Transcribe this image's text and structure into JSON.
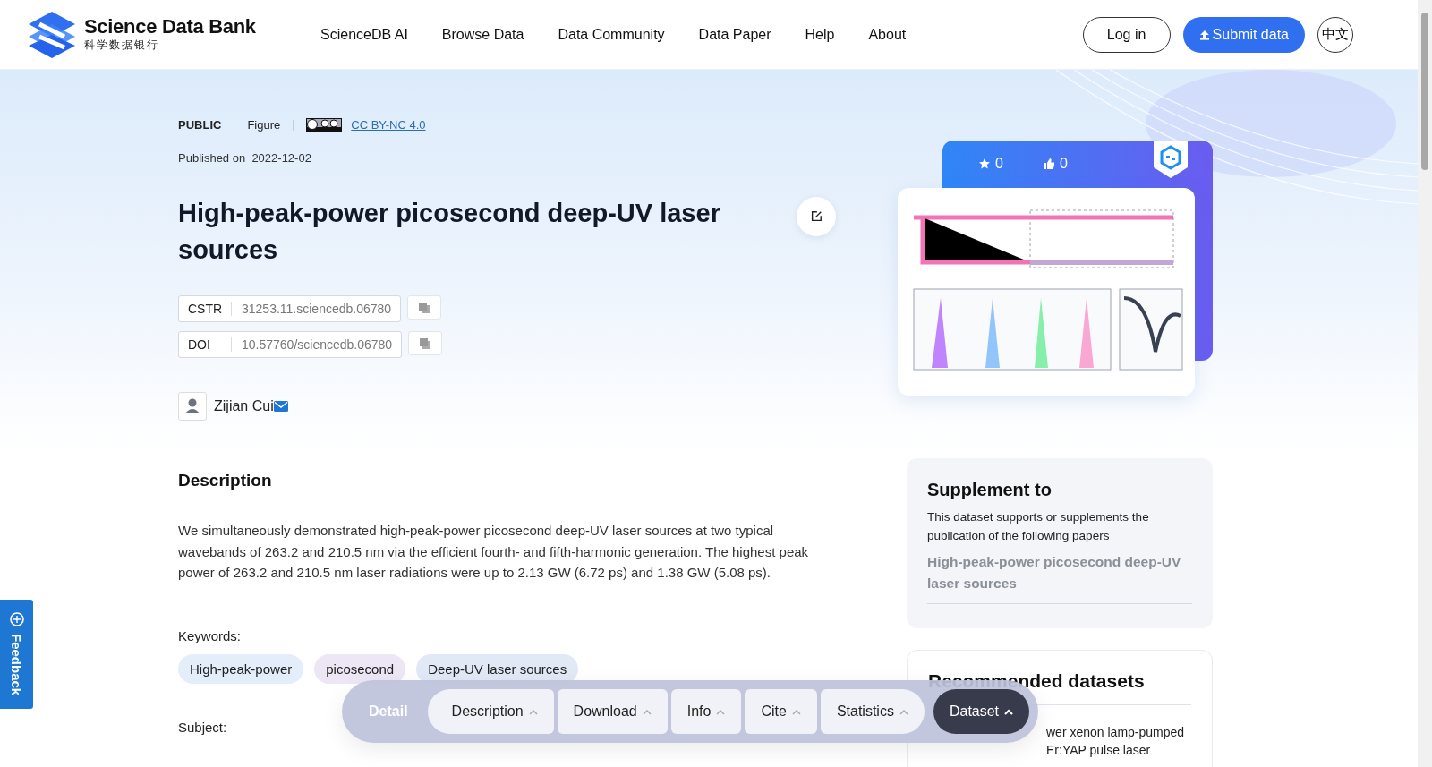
{
  "header": {
    "logo": {
      "name": "Science Data Bank",
      "subtitle": "科学数据银行"
    },
    "nav": [
      "ScienceDB AI",
      "Browse Data",
      "Data Community",
      "Data Paper",
      "Help",
      "About"
    ],
    "login": "Log in",
    "submit": "Submit data",
    "language": "中文"
  },
  "meta": {
    "access": "PUBLIC",
    "type": "Figure",
    "license": "CC BY-NC 4.0",
    "published_label": "Published on",
    "published_date": "2022-12-02"
  },
  "title": "High-peak-power picosecond deep-UV laser sources",
  "identifiers": [
    {
      "label": "CSTR",
      "value": "31253.11.sciencedb.06780"
    },
    {
      "label": "DOI",
      "value": "10.57760/sciencedb.06780"
    }
  ],
  "author": {
    "name": "Zijian Cui"
  },
  "description": {
    "heading": "Description",
    "text": "We simultaneously demonstrated high-peak-power picosecond deep-UV laser sources at two typical wavebands of 263.2 and 210.5 nm via the efficient fourth- and fifth-harmonic generation. The highest peak power of 263.2 and 210.5 nm laser radiations were up to 2.13 GW (6.72 ps) and 1.38 GW (5.08 ps)."
  },
  "keywords": {
    "label": "Keywords:",
    "items": [
      {
        "text": "High-peak-power",
        "color": "#e4edfa"
      },
      {
        "text": "picosecond",
        "color": "#ece6f5"
      },
      {
        "text": "Deep-UV laser sources",
        "color": "#e2e9f6"
      }
    ]
  },
  "subject": {
    "label": "Subject:"
  },
  "stats": {
    "stars": "0",
    "likes": "0"
  },
  "supplement": {
    "title": "Supplement to",
    "text": "This dataset supports or supplements the publication of the following papers",
    "paper": "High-peak-power picosecond deep-UV laser sources"
  },
  "recommended": {
    "title": "Recommended datasets",
    "items": [
      "wer xenon lamp-pumped Er:YAP pulse laser"
    ]
  },
  "detail_bar": {
    "label": "Detail",
    "tabs": [
      {
        "label": "Description",
        "selected": false
      },
      {
        "label": "Download",
        "selected": false
      },
      {
        "label": "Info",
        "selected": false
      },
      {
        "label": "Cite",
        "selected": false
      },
      {
        "label": "Statistics",
        "selected": false
      },
      {
        "label": "Dataset",
        "selected": true
      }
    ]
  },
  "feedback": {
    "label": "Feedback"
  }
}
